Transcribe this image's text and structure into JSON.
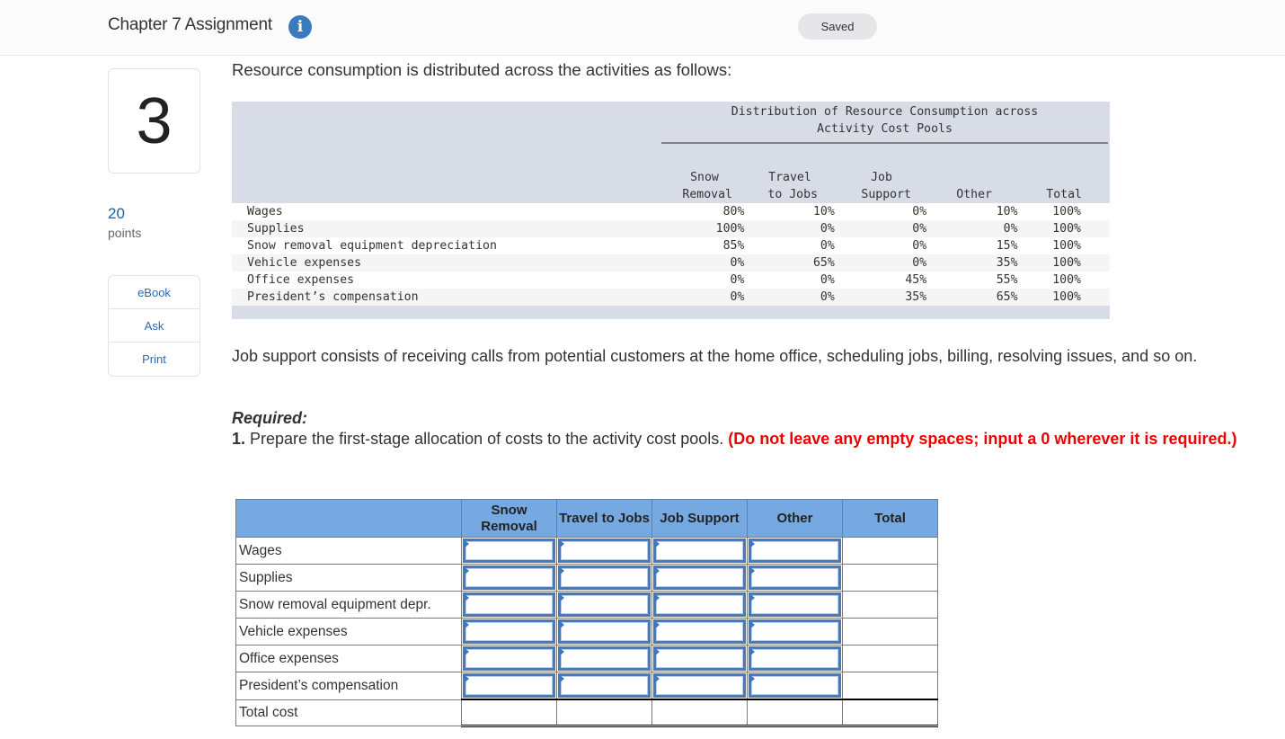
{
  "header": {
    "title": "Chapter 7 Assignment",
    "info_icon": "info-icon",
    "status": "Saved"
  },
  "sidebar": {
    "question_number": "3",
    "points_value": "20",
    "points_label": "points",
    "tools": [
      {
        "label": "eBook"
      },
      {
        "label": "Ask"
      },
      {
        "label": "Print"
      }
    ]
  },
  "intro_text": "Resource consumption is distributed across the activities as follows:",
  "distribution_table": {
    "caption_line1": "Distribution of Resource Consumption across",
    "caption_line2": "Activity Cost Pools",
    "columns": [
      {
        "line1": "Snow",
        "line2": "Removal"
      },
      {
        "line1": "Travel",
        "line2": "to Jobs"
      },
      {
        "line1": "Job",
        "line2": "Support"
      },
      {
        "line1": "",
        "line2": "Other"
      },
      {
        "line1": "",
        "line2": "Total"
      }
    ],
    "rows": [
      {
        "label": "Wages",
        "values": [
          "80%",
          "10%",
          "0%",
          "10%",
          "100%"
        ]
      },
      {
        "label": "Supplies",
        "values": [
          "100%",
          "0%",
          "0%",
          "0%",
          "100%"
        ]
      },
      {
        "label": "Snow removal equipment depreciation",
        "values": [
          "85%",
          "0%",
          "0%",
          "15%",
          "100%"
        ]
      },
      {
        "label": "Vehicle expenses",
        "values": [
          "0%",
          "65%",
          "0%",
          "35%",
          "100%"
        ]
      },
      {
        "label": "Office expenses",
        "values": [
          "0%",
          "0%",
          "45%",
          "55%",
          "100%"
        ]
      },
      {
        "label": "President’s compensation",
        "values": [
          "0%",
          "0%",
          "35%",
          "65%",
          "100%"
        ]
      }
    ]
  },
  "job_support_text": "Job support consists of receiving calls from potential customers at the home office, scheduling jobs, billing, resolving issues, and so on.",
  "required": {
    "label": "Required:",
    "number": "1.",
    "instruction": " Prepare the first-stage allocation of costs to the activity cost pools. ",
    "warning": "(Do not leave any empty spaces; input a 0 wherever it is required.)"
  },
  "answer_table": {
    "headers": [
      "",
      "Snow Removal",
      "Travel to Jobs",
      "Job Support",
      "Other",
      "Total"
    ],
    "rows": [
      {
        "label": "Wages",
        "inputs": [
          "",
          "",
          "",
          ""
        ],
        "total": ""
      },
      {
        "label": "Supplies",
        "inputs": [
          "",
          "",
          "",
          ""
        ],
        "total": ""
      },
      {
        "label": "Snow removal equipment depr.",
        "inputs": [
          "",
          "",
          "",
          ""
        ],
        "total": ""
      },
      {
        "label": "Vehicle expenses",
        "inputs": [
          "",
          "",
          "",
          ""
        ],
        "total": ""
      },
      {
        "label": "Office expenses",
        "inputs": [
          "",
          "",
          "",
          ""
        ],
        "total": ""
      },
      {
        "label": "President’s compensation",
        "inputs": [
          "",
          "",
          "",
          ""
        ],
        "total": ""
      }
    ],
    "total_row": {
      "label": "Total cost",
      "values": [
        "",
        "",
        "",
        "",
        ""
      ]
    }
  },
  "colors": {
    "accent_blue": "#3a7bbf",
    "link_blue": "#2a6ab3",
    "warning_red": "#ee0000",
    "table_header_blue": "#76a9e2",
    "dist_table_bg": "#d7dce6"
  }
}
